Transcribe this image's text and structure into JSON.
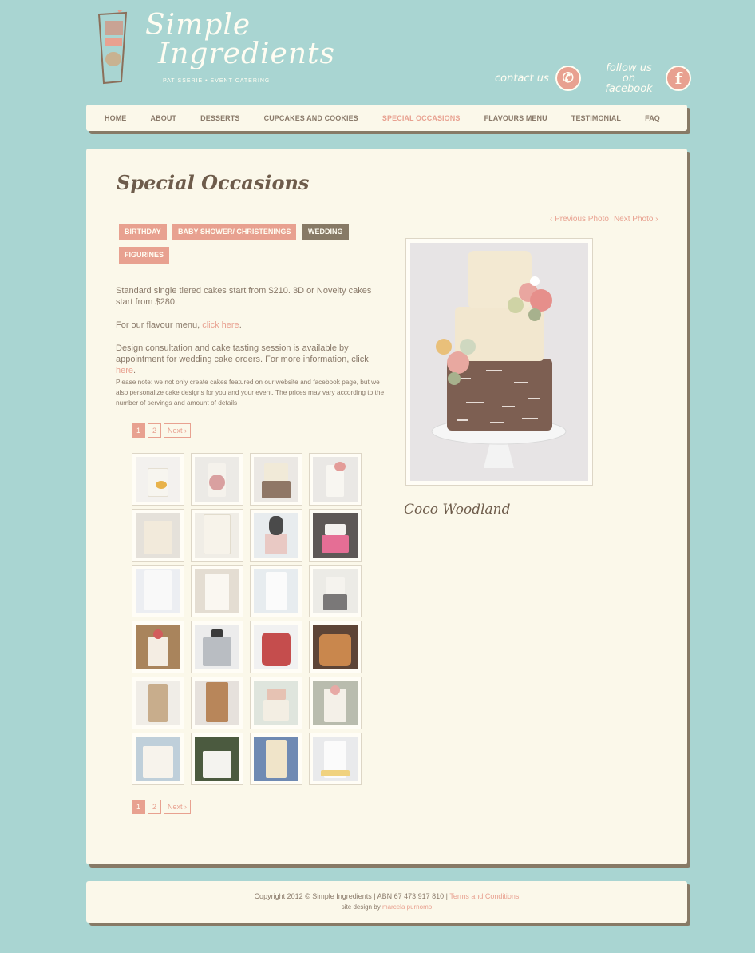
{
  "brand": {
    "name_line1": "Simple",
    "name_line2": "Ingredients",
    "tagline": "PATISSERIE • EVENT CATERING"
  },
  "header": {
    "contact_label": "contact us",
    "follow_label_1": "follow us",
    "follow_label_2": "on facebook",
    "phone_icon": "phone-icon",
    "facebook_icon": "facebook-icon"
  },
  "nav": {
    "items": [
      {
        "label": "HOME"
      },
      {
        "label": "ABOUT"
      },
      {
        "label": "DESSERTS"
      },
      {
        "label": "CUPCAKES AND COOKIES"
      },
      {
        "label": "SPECIAL OCCASIONS",
        "active": true
      },
      {
        "label": "FLAVOURS MENU"
      },
      {
        "label": "TESTIMONIAL"
      },
      {
        "label": "FAQ"
      }
    ]
  },
  "main": {
    "title": "Special Occasions",
    "categories": [
      {
        "label": "BIRTHDAY"
      },
      {
        "label": "BABY SHOWER/ CHRISTENINGS"
      },
      {
        "label": "WEDDING",
        "active": true
      },
      {
        "label": "FIGURINES"
      }
    ],
    "p1": "Standard single tiered cakes start from $210. 3D or Novelty cakes start from $280.",
    "p2_text": "For our flavour menu, ",
    "p2_link": "click here",
    "p2_end": ".",
    "p3_text": "Design consultation and cake tasting session is available by appointment for wedding cake orders. For more information, click ",
    "p3_link": "here",
    "p3_end": ".",
    "note": "Please note: we not only create cakes featured on our website and facebook page, but we also personalize cake designs for you and your event. The prices may vary according to the number of servings and amount of details",
    "pager": {
      "page1": "1",
      "page2": "2",
      "next": "Next ›"
    },
    "prev_photo": "‹ Previous Photo",
    "next_photo": "Next Photo ›",
    "photo_caption": "Coco Woodland"
  },
  "footer": {
    "copyright": "Copyright 2012 © Simple Ingredients | ABN 67 473 917 810 | ",
    "terms": "Terms and Conditions",
    "design_by": "site design by ",
    "designer": "marcela purnomo"
  }
}
